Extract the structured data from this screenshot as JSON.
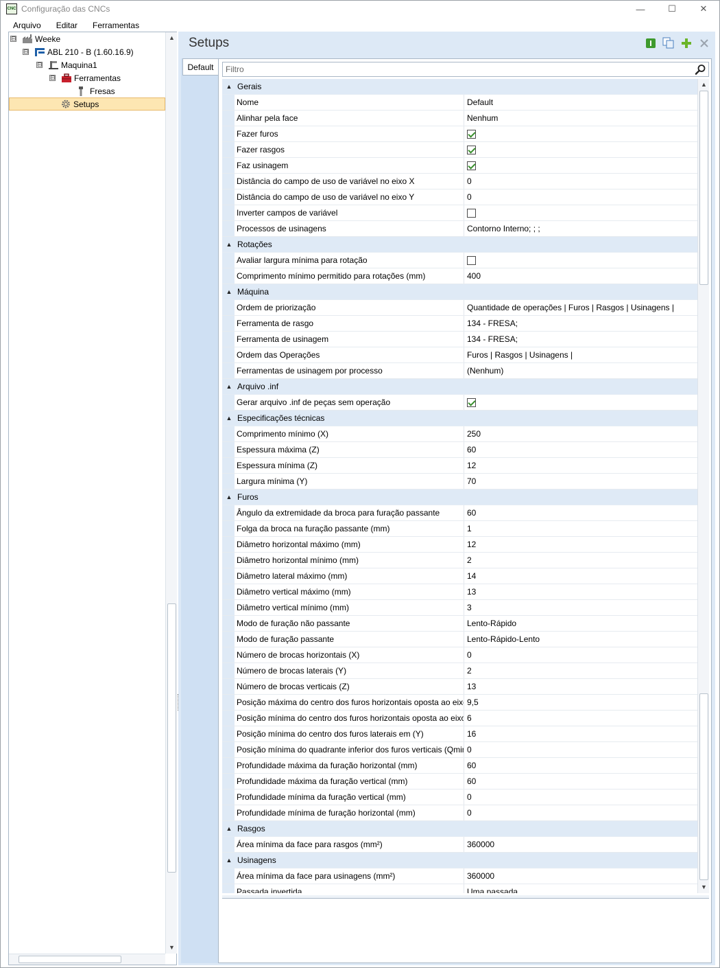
{
  "window": {
    "title": "Configuração das CNCs",
    "icon_text": "CNC",
    "controls": {
      "minimize": "—",
      "maximize": "☐",
      "close": "✕"
    }
  },
  "menubar": [
    "Arquivo",
    "Editar",
    "Ferramentas"
  ],
  "tree": {
    "nodes": [
      {
        "label": "Weeke",
        "toggle": "⊟",
        "icon": "factory-icon"
      },
      {
        "label": "ABL 210 - B (1.60.16.9)",
        "toggle": "⊟",
        "icon": "machine-model-icon"
      },
      {
        "label": "Maquina1",
        "toggle": "⊟",
        "icon": "machine-icon"
      },
      {
        "label": "Ferramentas",
        "toggle": "⊟",
        "icon": "toolbox-icon"
      },
      {
        "label": "Fresas",
        "toggle": "",
        "icon": "drill-bit-icon"
      },
      {
        "label": "Setups",
        "toggle": "",
        "icon": "gear-icon",
        "selected": true
      }
    ]
  },
  "panel": {
    "title": "Setups",
    "tab": "Default",
    "filter_placeholder": "Filtro",
    "toolbar": [
      "info-icon",
      "copy-icon",
      "add-icon",
      "delete-icon"
    ]
  },
  "property_grid": {
    "categories": [
      {
        "name": "Gerais",
        "rows": [
          {
            "name": "Nome",
            "value": "Default"
          },
          {
            "name": "Alinhar pela face",
            "value": "Nenhum"
          },
          {
            "name": "Fazer furos",
            "checked": true
          },
          {
            "name": "Fazer rasgos",
            "checked": true
          },
          {
            "name": "Faz usinagem",
            "checked": true
          },
          {
            "name": "Distância do campo de uso de variável no eixo X",
            "value": "0"
          },
          {
            "name": "Distância do campo de uso de variável no eixo Y",
            "value": "0"
          },
          {
            "name": "Inverter campos de variável",
            "checked": false
          },
          {
            "name": "Processos de usinagens",
            "value": "Contorno Interno; ; ;"
          }
        ]
      },
      {
        "name": "Rotações",
        "rows": [
          {
            "name": "Avaliar largura mínima para rotação",
            "checked": false
          },
          {
            "name": "Comprimento mínimo permitido para rotações (mm)",
            "value": "400"
          }
        ]
      },
      {
        "name": "Máquina",
        "rows": [
          {
            "name": "Ordem de priorização",
            "value": "Quantidade de operações | Furos | Rasgos | Usinagens |"
          },
          {
            "name": "Ferramenta de rasgo",
            "value": "134 - FRESA;"
          },
          {
            "name": "Ferramenta de usinagem",
            "value": "134 - FRESA;"
          },
          {
            "name": "Ordem das Operações",
            "value": "Furos | Rasgos | Usinagens |"
          },
          {
            "name": "Ferramentas de usinagem por processo",
            "value": "(Nenhum)"
          }
        ]
      },
      {
        "name": "Arquivo .inf",
        "rows": [
          {
            "name": "Gerar arquivo .inf de peças sem operação",
            "checked": true
          }
        ]
      },
      {
        "name": "Especificações técnicas",
        "rows": [
          {
            "name": "Comprimento mínimo (X)",
            "value": "250"
          },
          {
            "name": "Espessura máxima (Z)",
            "value": "60"
          },
          {
            "name": "Espessura mínima (Z)",
            "value": "12"
          },
          {
            "name": "Largura mínima (Y)",
            "value": "70"
          }
        ]
      },
      {
        "name": "Furos",
        "rows": [
          {
            "name": "Ângulo da extremidade da broca para furação passante",
            "value": "60"
          },
          {
            "name": "Folga da broca na furação passante (mm)",
            "value": "1"
          },
          {
            "name": "Diâmetro horizontal máximo (mm)",
            "value": "12"
          },
          {
            "name": "Diâmetro horizontal mínimo (mm)",
            "value": "2"
          },
          {
            "name": "Diâmetro lateral máximo (mm)",
            "value": "14"
          },
          {
            "name": "Diâmetro vertical máximo (mm)",
            "value": "13"
          },
          {
            "name": "Diâmetro vertical mínimo (mm)",
            "value": "3"
          },
          {
            "name": "Modo de furação não passante",
            "value": "Lento-Rápido"
          },
          {
            "name": "Modo de furação passante",
            "value": "Lento-Rápido-Lento"
          },
          {
            "name": "Número de brocas horizontais (X)",
            "value": "0"
          },
          {
            "name": "Número de brocas laterais (Y)",
            "value": "2"
          },
          {
            "name": "Número de brocas verticais (Z)",
            "value": "13"
          },
          {
            "name": "Posição máxima do centro dos furos horizontais oposta ao eixo Y...",
            "value": "9,5"
          },
          {
            "name": "Posição mínima do centro dos furos horizontais oposta ao eixo Y...",
            "value": "6"
          },
          {
            "name": "Posição mínima do centro dos furos laterais em (Y)",
            "value": "16"
          },
          {
            "name": "Posição mínima do quadrante inferior dos furos verticais (Qmin)...",
            "value": "0"
          },
          {
            "name": "Profundidade máxima da furação horizontal (mm)",
            "value": "60"
          },
          {
            "name": "Profundidade máxima da furação vertical (mm)",
            "value": "60"
          },
          {
            "name": "Profundidade mínima da furação vertical (mm)",
            "value": "0"
          },
          {
            "name": "Profundidade mínima de furação horizontal (mm)",
            "value": "0"
          }
        ]
      },
      {
        "name": "Rasgos",
        "rows": [
          {
            "name": "Área mínima da face para rasgos (mm²)",
            "value": "360000"
          }
        ]
      },
      {
        "name": "Usinagens",
        "rows": [
          {
            "name": "Área mínima da face para usinagens (mm²)",
            "value": "360000"
          },
          {
            "name": "Passada invertida",
            "value": "Uma passada"
          }
        ]
      }
    ]
  },
  "colors": {
    "panel_bg": "#dde9f6",
    "category_bg": "#dfeaf6",
    "selection_bg": "#fde6b2",
    "check_green": "#3a8f2e"
  }
}
